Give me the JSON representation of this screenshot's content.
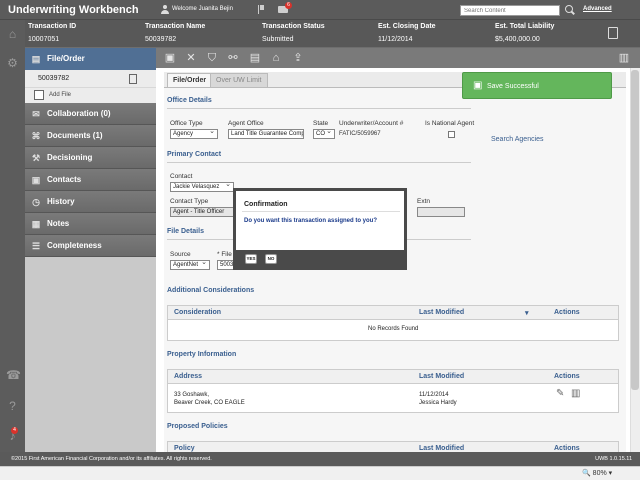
{
  "header": {
    "app_title": "Underwriting Workbench",
    "welcome": "Welcome Juanita Bejin",
    "mail_badge": "6",
    "search_placeholder": "Search Content",
    "advanced_label": "Advanced"
  },
  "infobar": {
    "columns": [
      {
        "label": "Transaction ID",
        "value": "10007051"
      },
      {
        "label": "Transaction Name",
        "value": "50039782"
      },
      {
        "label": "Transaction Status",
        "value": "Submitted"
      },
      {
        "label": "Est. Closing Date",
        "value": "11/12/2014"
      },
      {
        "label": "Est. Total Liability",
        "value": "$5,400,000.00"
      }
    ]
  },
  "sidebar": {
    "head": "File/Order",
    "file_number": "50039782",
    "add_file": "Add File",
    "items": [
      {
        "label": "Collaboration (0)",
        "icon": "chat-icon"
      },
      {
        "label": "Documents (1)",
        "icon": "paperclip-icon"
      },
      {
        "label": "Decisioning",
        "icon": "gavel-icon"
      },
      {
        "label": "Contacts",
        "icon": "contacts-icon"
      },
      {
        "label": "History",
        "icon": "clock-icon"
      },
      {
        "label": "Notes",
        "icon": "notes-icon"
      },
      {
        "label": "Completeness",
        "icon": "checklist-icon"
      }
    ]
  },
  "tabs": {
    "file_order": "File/Order",
    "over_uw_limit": "Over UW Limit"
  },
  "office": {
    "section_title": "Office Details",
    "office_type_label": "Office Type",
    "office_type_value": "Agency",
    "agent_office_label": "Agent Office",
    "agent_office_value": "Land Title Guarantee Comp",
    "state_label": "State",
    "state_value": "CO",
    "underwriter_label": "Underwriter/Account #",
    "underwriter_value": "FATIC/5059967",
    "national_agent_label": "Is National Agent",
    "search_agencies": "Search Agencies"
  },
  "contact": {
    "section_title": "Primary Contact",
    "contact_label": "Contact",
    "contact_value": "Jackie Velasquez",
    "contact_type_label": "Contact Type",
    "contact_type_value": "Agent - Title Officer",
    "extn_label": "Extn"
  },
  "file_details": {
    "section_title": "File Details",
    "source_label": "Source",
    "source_value": "AgentNet",
    "file_label": "* File",
    "file_value": "5003"
  },
  "additional": {
    "section_title": "Additional Considerations",
    "col_consideration": "Consideration",
    "col_last_modified": "Last Modified",
    "col_actions": "Actions",
    "empty": "No Records Found"
  },
  "property": {
    "section_title": "Property Information",
    "col_address": "Address",
    "col_last_modified": "Last Modified",
    "col_actions": "Actions",
    "address_line1": "33 Goshawk,",
    "address_line2": "Beaver Creek, CO EAGLE",
    "modified_date": "11/12/2014",
    "modified_by": "Jessica Hardy"
  },
  "policies": {
    "section_title": "Proposed Policies",
    "col_policy": "Policy",
    "col_last_modified": "Last Modified",
    "col_actions": "Actions"
  },
  "toast": {
    "message": "Save Successful"
  },
  "dialog": {
    "title": "Confirmation",
    "message": "Do you want this transaction assigned to you?",
    "yes": "YES",
    "no": "NO"
  },
  "footer": {
    "copyright": "©2015 First American Financial Corporation and/or its affiliates. All rights reserved.",
    "version": "UWB 1.0.15.11"
  },
  "statusbar": {
    "zoom": "80%"
  },
  "rail": {
    "alert_badge": "4"
  }
}
